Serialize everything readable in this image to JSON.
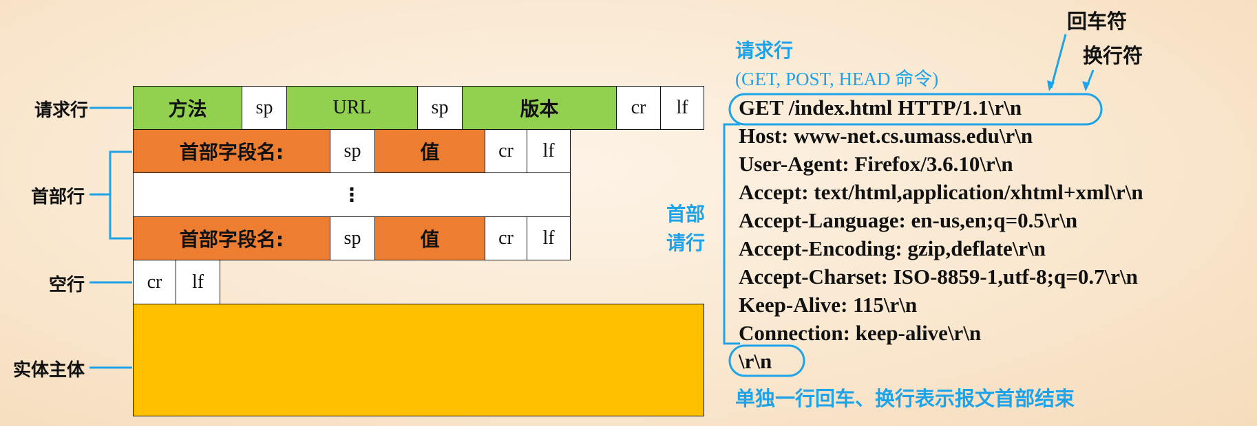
{
  "row_labels": {
    "request_line": "请求行",
    "header_lines": "首部行",
    "blank_line": "空行",
    "entity_body": "实体主体"
  },
  "request_line_cells": {
    "method": "方法",
    "sp1": "sp",
    "url": "URL",
    "sp2": "sp",
    "version": "版本",
    "cr": "cr",
    "lf": "lf"
  },
  "header_line_cells": {
    "field_name": "首部字段名:",
    "sp": "sp",
    "value": "值",
    "cr": "cr",
    "lf": "lf"
  },
  "ellipsis": "⋮",
  "blank_line_cells": {
    "cr": "cr",
    "lf": "lf"
  },
  "annotations": {
    "carriage_return": "回车符",
    "line_feed": "换行符",
    "request_line_title": "请求行",
    "request_line_note": "(GET, POST, HEAD 命令)",
    "header_lines_label_1": "首部",
    "header_lines_label_2": "请行",
    "blank_line_note": "单独一行回车、换行表示报文首部结束"
  },
  "http_request": [
    "GET /index.html HTTP/1.1\\r\\n",
    "Host: www-net.cs.umass.edu\\r\\n",
    "User-Agent: Firefox/3.6.10\\r\\n",
    "Accept: text/html,application/xhtml+xml\\r\\n",
    "Accept-Language: en-us,en;q=0.5\\r\\n",
    "Accept-Encoding: gzip,deflate\\r\\n",
    "Accept-Charset: ISO-8859-1,utf-8;q=0.7\\r\\n",
    "Keep-Alive: 115\\r\\n",
    "Connection: keep-alive\\r\\n",
    "\\r\\n"
  ],
  "colors": {
    "request_line": "#92d050",
    "header_line": "#ed7d31",
    "entity_body": "#ffc000",
    "annotation": "#1fa3e8"
  }
}
